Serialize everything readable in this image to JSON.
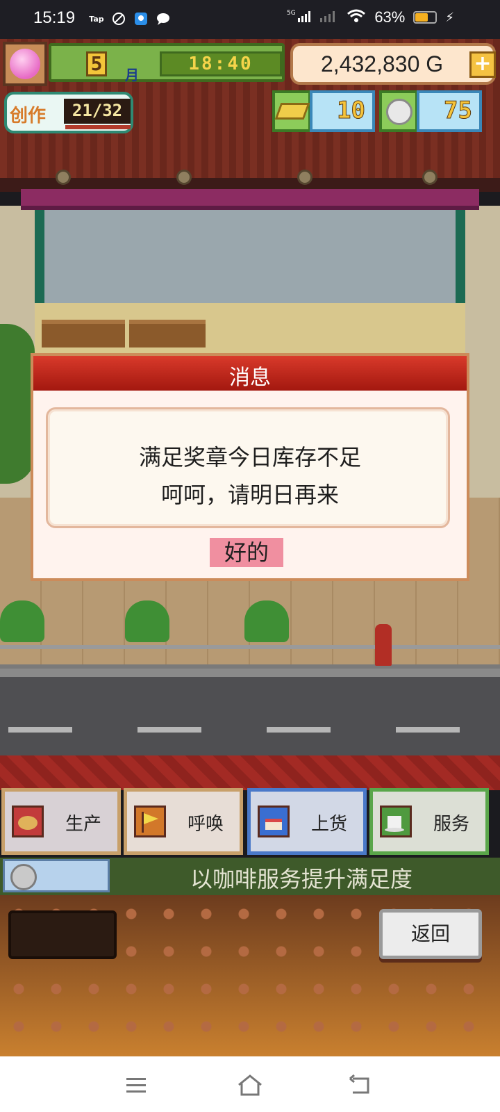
{
  "status_bar": {
    "time": "15:19",
    "battery_percent": "63%",
    "icons": [
      "taptap-icon",
      "app-icon",
      "qq-icon",
      "message-icon"
    ]
  },
  "hud": {
    "month_number": "5",
    "month_label": "月",
    "clock": "18:40",
    "money": "2,432,830 G",
    "create_label": "创作",
    "create_count": "21/32",
    "gold_value": "10",
    "medal_value": "75"
  },
  "dialog": {
    "title": "消息",
    "lines": [
      "满足奖章今日库存不足",
      "呵呵，请明日再来"
    ],
    "ok_label": "好的"
  },
  "menu": {
    "buttons": [
      {
        "label": "生产",
        "icon": "bread-icon"
      },
      {
        "label": "呼唤",
        "icon": "flag-icon"
      },
      {
        "label": "上货",
        "icon": "cake-icon"
      },
      {
        "label": "服务",
        "icon": "coffee-cup-icon"
      }
    ]
  },
  "hint": "以咖啡服务提升满足度",
  "panel": {
    "back_label": "返回"
  },
  "colors": {
    "dialog_header": "#c0261c",
    "ok_button": "#f08fa0",
    "hint_bg": "#3e5a2a"
  }
}
